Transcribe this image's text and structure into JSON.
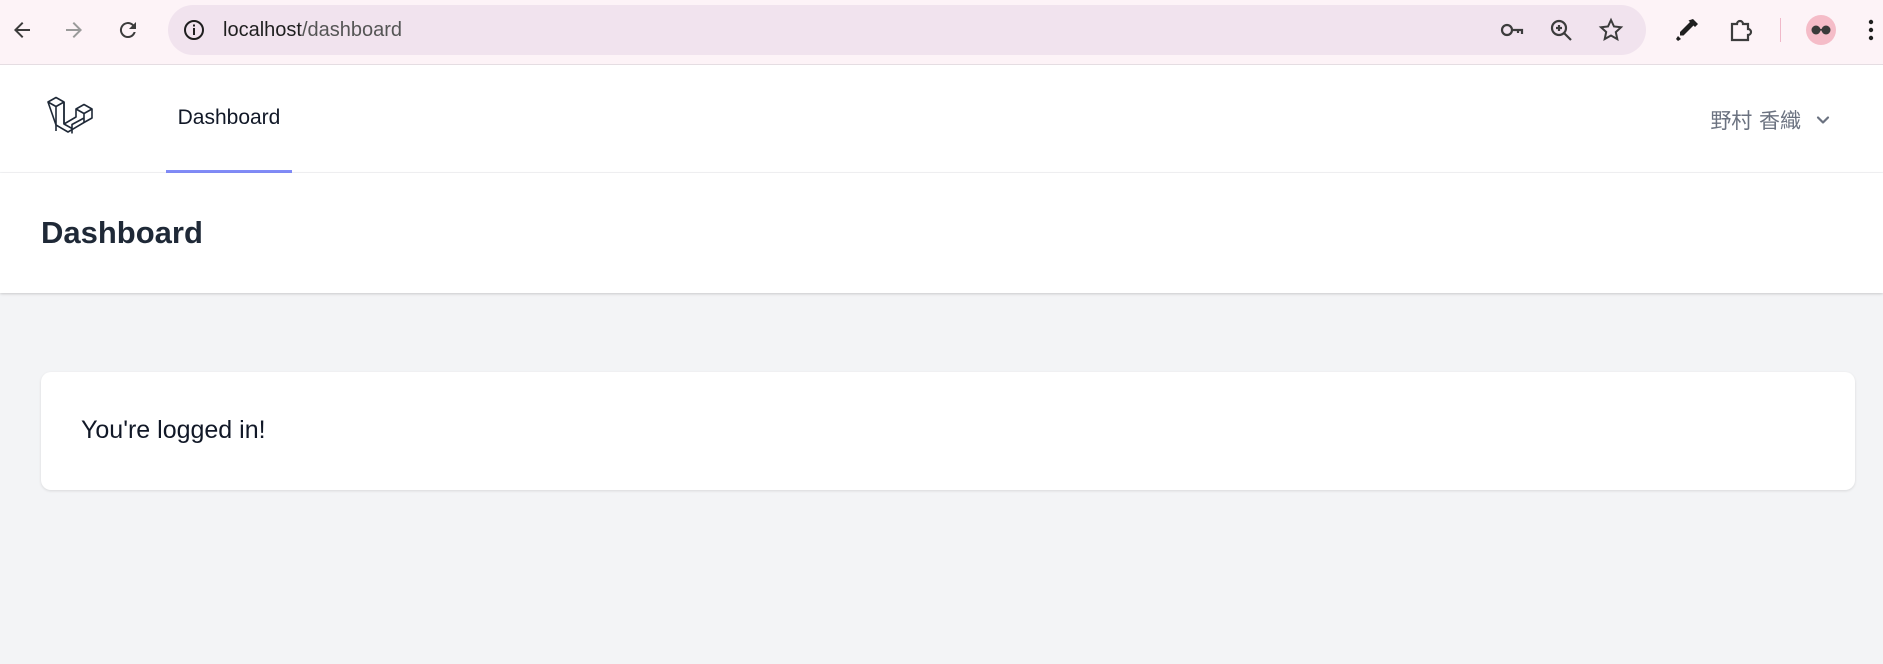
{
  "browser": {
    "url_host": "localhost",
    "url_path": "/dashboard",
    "icons": [
      "back-arrow-icon",
      "forward-arrow-icon",
      "reload-icon",
      "site-info-icon",
      "password-key-icon",
      "zoom-icon",
      "bookmark-star-icon",
      "eyedropper-icon",
      "extensions-puzzle-icon",
      "profile-avatar-icon",
      "more-menu-icon"
    ]
  },
  "nav": {
    "dashboard_link": "Dashboard",
    "user_name": "野村 香織",
    "accent_color": "#818cf8"
  },
  "header": {
    "title": "Dashboard"
  },
  "main": {
    "message": "You're logged in!"
  }
}
